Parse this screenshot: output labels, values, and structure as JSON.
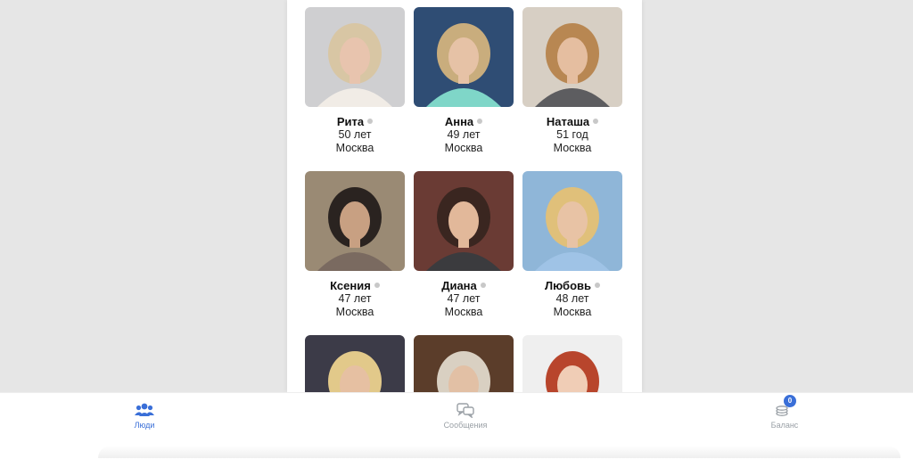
{
  "people": [
    {
      "name": "Рита",
      "age": "50 лет",
      "city": "Москва",
      "photo": "photo-blonde-curly-woman",
      "colors": {
        "bg": "#cfcfd1",
        "hair": "#d8c6a4",
        "skin": "#e8c4ae",
        "cloth": "#f1ece6"
      }
    },
    {
      "name": "Анна",
      "age": "49 лет",
      "city": "Москва",
      "photo": "photo-blonde-woman-mint-top",
      "colors": {
        "bg": "#2f4d74",
        "hair": "#c9ad7d",
        "skin": "#e6c2a6",
        "cloth": "#7fd6c8"
      }
    },
    {
      "name": "Наташа",
      "age": "51 год",
      "city": "Москва",
      "photo": "photo-long-hair-woman-indoor",
      "colors": {
        "bg": "#d7cfc4",
        "hair": "#b88752",
        "skin": "#e5bea0",
        "cloth": "#5d5d60"
      }
    },
    {
      "name": "Ксения",
      "age": "47 лет",
      "city": "Москва",
      "photo": "photo-woman-sitting-outdoors",
      "colors": {
        "bg": "#9a8a74",
        "hair": "#2a2320",
        "skin": "#c8a082",
        "cloth": "#7a6a60"
      }
    },
    {
      "name": "Диана",
      "age": "47 лет",
      "city": "Москва",
      "photo": "photo-dark-hair-woman-smiling",
      "colors": {
        "bg": "#6a3b34",
        "hair": "#3a2620",
        "skin": "#e2b89a",
        "cloth": "#3b3b3e"
      }
    },
    {
      "name": "Любовь",
      "age": "48 лет",
      "city": "Москва",
      "photo": "photo-woman-mountains",
      "colors": {
        "bg": "#8fb6d8",
        "hair": "#e0c07a",
        "skin": "#e8c3a5",
        "cloth": "#9fc3e6"
      }
    },
    {
      "name": "",
      "age": "",
      "city": "",
      "photo": "photo-short-blonde-woman-car",
      "colors": {
        "bg": "#3c3b48",
        "hair": "#e2c98a",
        "skin": "#e6c0a2",
        "cloth": "#2c2c34"
      }
    },
    {
      "name": "",
      "age": "",
      "city": "",
      "photo": "photo-woman-wine-shelf",
      "colors": {
        "bg": "#5b3d2a",
        "hair": "#d9d0c2",
        "skin": "#e2c0a5",
        "cloth": "#1f1f22"
      }
    },
    {
      "name": "",
      "age": "",
      "city": "",
      "photo": "photo-red-hair-woman-glasses",
      "colors": {
        "bg": "#efefef",
        "hair": "#b8452c",
        "skin": "#f0cdb6",
        "cloth": "#ffffff"
      }
    }
  ],
  "nav": {
    "people": {
      "label": "Люди",
      "icon": "people-icon"
    },
    "messages": {
      "label": "Сообщения",
      "icon": "chat-icon"
    },
    "balance": {
      "label": "Баланс",
      "icon": "coins-icon",
      "badge": "0"
    }
  },
  "colors": {
    "accent": "#3a6fd8",
    "inactive": "#9aa0a6",
    "status_offline": "#c8c8c8"
  }
}
